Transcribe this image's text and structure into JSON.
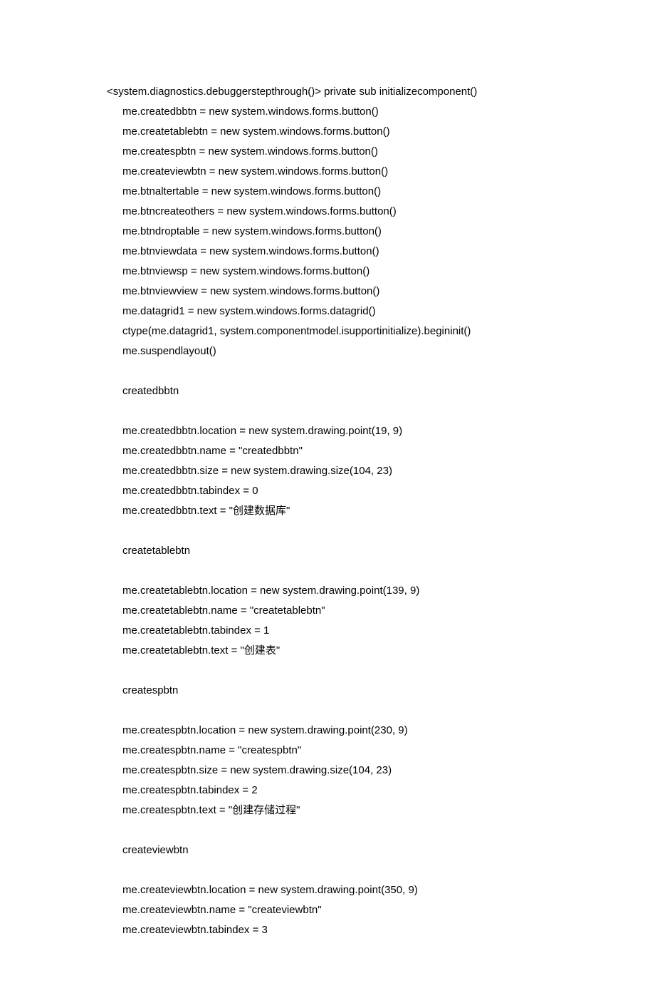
{
  "lines": [
    {
      "indent": 0,
      "text": "<system.diagnostics.debuggerstepthrough()> private sub initializecomponent()"
    },
    {
      "indent": 1,
      "text": "me.createdbbtn = new system.windows.forms.button()"
    },
    {
      "indent": 1,
      "text": "me.createtablebtn = new system.windows.forms.button()"
    },
    {
      "indent": 1,
      "text": "me.createspbtn = new system.windows.forms.button()"
    },
    {
      "indent": 1,
      "text": "me.createviewbtn = new system.windows.forms.button()"
    },
    {
      "indent": 1,
      "text": "me.btnaltertable = new system.windows.forms.button()"
    },
    {
      "indent": 1,
      "text": "me.btncreateothers = new system.windows.forms.button()"
    },
    {
      "indent": 1,
      "text": "me.btndroptable = new system.windows.forms.button()"
    },
    {
      "indent": 1,
      "text": "me.btnviewdata = new system.windows.forms.button()"
    },
    {
      "indent": 1,
      "text": "me.btnviewsp = new system.windows.forms.button()"
    },
    {
      "indent": 1,
      "text": "me.btnviewview = new system.windows.forms.button()"
    },
    {
      "indent": 1,
      "text": "me.datagrid1 = new system.windows.forms.datagrid()"
    },
    {
      "indent": 1,
      "text": "ctype(me.datagrid1, system.componentmodel.isupportinitialize).begininit()"
    },
    {
      "indent": 1,
      "text": "me.suspendlayout()"
    },
    {
      "blank": true
    },
    {
      "indent": 1,
      "text": "createdbbtn"
    },
    {
      "blank": true
    },
    {
      "indent": 1,
      "text": "me.createdbbtn.location = new system.drawing.point(19, 9)"
    },
    {
      "indent": 1,
      "text": "me.createdbbtn.name = \"createdbbtn\""
    },
    {
      "indent": 1,
      "text": "me.createdbbtn.size = new system.drawing.size(104, 23)"
    },
    {
      "indent": 1,
      "text": "me.createdbbtn.tabindex = 0"
    },
    {
      "indent": 1,
      "text": "me.createdbbtn.text = \"创建数据库\""
    },
    {
      "blank": true
    },
    {
      "indent": 1,
      "text": "createtablebtn"
    },
    {
      "blank": true
    },
    {
      "indent": 1,
      "text": "me.createtablebtn.location = new system.drawing.point(139, 9)"
    },
    {
      "indent": 1,
      "text": "me.createtablebtn.name = \"createtablebtn\""
    },
    {
      "indent": 1,
      "text": "me.createtablebtn.tabindex = 1"
    },
    {
      "indent": 1,
      "text": "me.createtablebtn.text = \"创建表\""
    },
    {
      "blank": true
    },
    {
      "indent": 1,
      "text": "createspbtn"
    },
    {
      "blank": true
    },
    {
      "indent": 1,
      "text": "me.createspbtn.location = new system.drawing.point(230, 9)"
    },
    {
      "indent": 1,
      "text": "me.createspbtn.name = \"createspbtn\""
    },
    {
      "indent": 1,
      "text": "me.createspbtn.size = new system.drawing.size(104, 23)"
    },
    {
      "indent": 1,
      "text": "me.createspbtn.tabindex = 2"
    },
    {
      "indent": 1,
      "text": "me.createspbtn.text = \"创建存储过程\""
    },
    {
      "blank": true
    },
    {
      "indent": 1,
      "text": "createviewbtn"
    },
    {
      "blank": true
    },
    {
      "indent": 1,
      "text": "me.createviewbtn.location = new system.drawing.point(350, 9)"
    },
    {
      "indent": 1,
      "text": "me.createviewbtn.name = \"createviewbtn\""
    },
    {
      "indent": 1,
      "text": "me.createviewbtn.tabindex = 3"
    }
  ]
}
